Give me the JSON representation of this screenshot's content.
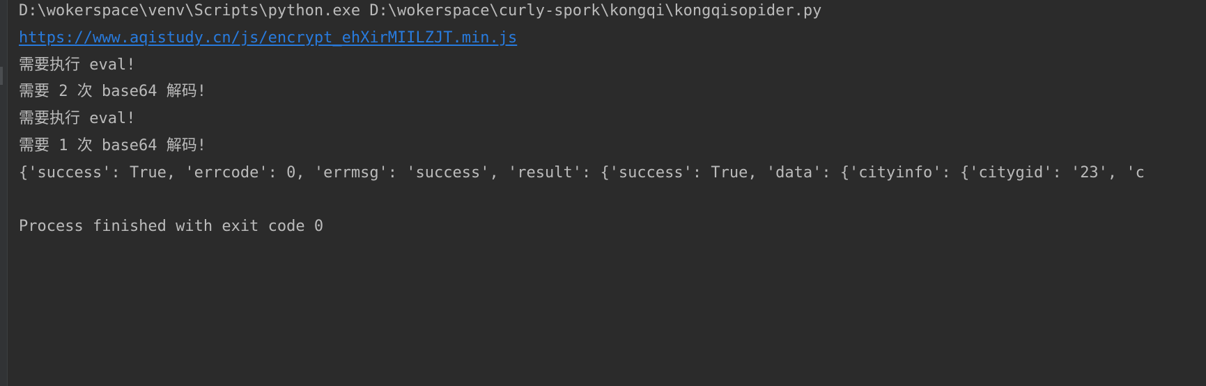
{
  "console": {
    "lines": {
      "command": "D:\\wokerspace\\venv\\Scripts\\python.exe D:\\wokerspace\\curly-spork\\kongqi\\kongqisopider.py",
      "link": "https://www.aqistudy.cn/js/encrypt_ehXirMIILZJT.min.js",
      "line3": "需要执行 eval!",
      "line4": "需要 2 次 base64 解码!",
      "line5": "需要执行 eval!",
      "line6": "需要 1 次 base64 解码!",
      "line7": "{'success': True, 'errcode': 0, 'errmsg': 'success', 'result': {'success': True, 'data': {'cityinfo': {'citygid': '23', 'c",
      "exit": "Process finished with exit code 0"
    },
    "colors": {
      "background": "#2b2b2b",
      "text": "#bbbbbb",
      "link": "#287bde"
    }
  }
}
